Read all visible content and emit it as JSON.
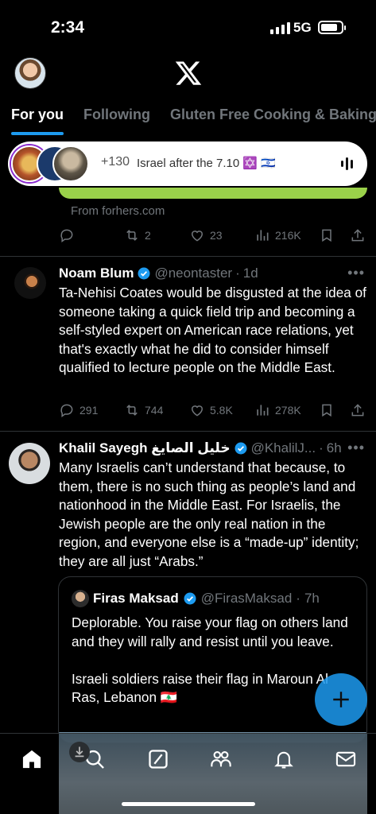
{
  "status_bar": {
    "time": "2:34",
    "network": "5G"
  },
  "tabs": [
    {
      "label": "For you",
      "active": true
    },
    {
      "label": "Following",
      "active": false
    },
    {
      "label": "Gluten Free Cooking & Baking",
      "active": false
    }
  ],
  "space": {
    "listener_count": "+130",
    "title": "Israel after the 7.10 ✡️ 🇮🇱"
  },
  "prev_tweet": {
    "from": "From forhers.com",
    "retweets": "2",
    "likes": "23",
    "views": "216K"
  },
  "tweets": [
    {
      "name": "Noam Blum",
      "handle": "@neontaster",
      "time": "1d",
      "text": "Ta-Nehisi Coates would be disgusted at the idea of someone taking a quick field trip and becoming a self-styled expert on American race relations, yet that's exactly what he did to consider himself qualified to lecture people on the Middle East.",
      "replies": "291",
      "retweets": "744",
      "likes": "5.8K",
      "views": "278K"
    },
    {
      "name": "Khalil Sayegh خليل الصايغ",
      "handle": "@KhalilJ...",
      "time": "6h",
      "text": "Many Israelis can’t understand that because, to them, there is no such thing as people’s land and nationhood in the Middle East. For Israelis, the Jewish people are the only real nation in the region, and everyone else is a “made-up” identity; they are all just “Arabs.”",
      "quote": {
        "name": "Firas Maksad",
        "handle": "@FirasMaksad",
        "time": "7h",
        "text_1": "Deplorable. You raise your flag on others land and they will rally and resist until you leave.",
        "text_2": "Israeli soldiers raise their flag in Maroun Al Ras, Lebanon 🇱🇧"
      }
    }
  ],
  "colors": {
    "accent": "#1d9bf0",
    "muted": "#71767b",
    "background": "#000000"
  }
}
